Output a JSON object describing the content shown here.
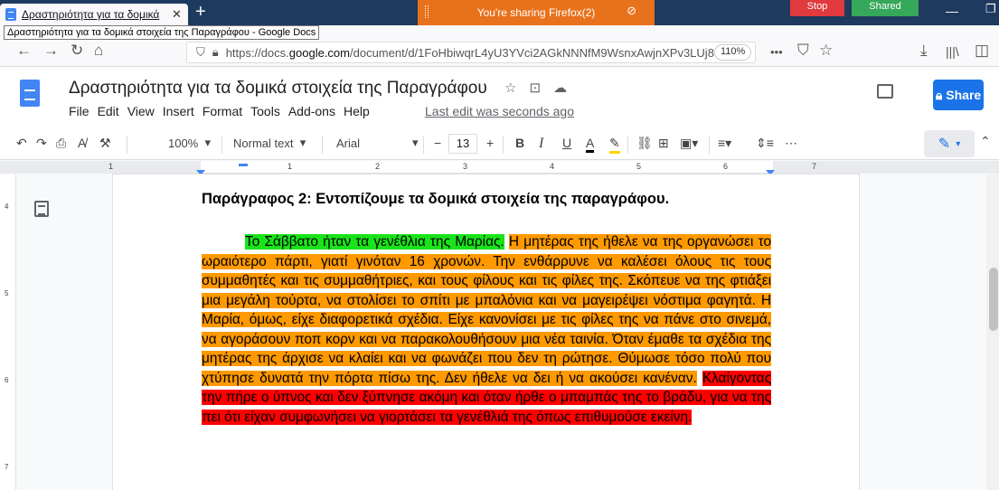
{
  "browser": {
    "tab_title": "Δραστηριότητα για τα δομικά",
    "tab_close": "✕",
    "new_tab": "+",
    "tooltip": "Δραστηριότητα για τα δομικά στοιχεία της Παραγράφου - Google Docs",
    "sharing_text": "You're sharing Firefox(2)",
    "stop_label": "Stop",
    "shared_label": "Shared",
    "url_prefix": "https://docs.",
    "url_domain": "google.com",
    "url_rest": "/document/d/1FoHbiwqrL4yU3YVci2AGkNNNfM9WsnxAwjnXPv3LUj8",
    "zoom": "110%",
    "more": "•••"
  },
  "docs": {
    "title": "Δραστηριότητα για τα δομικά στοιχεία της Παραγράφου",
    "menu": [
      "File",
      "Edit",
      "View",
      "Insert",
      "Format",
      "Tools",
      "Add-ons",
      "Help"
    ],
    "last_edit": "Last edit was seconds ago",
    "share_label": "Share",
    "zoom": "100%",
    "style": "Normal text",
    "font": "Arial",
    "font_size": "13"
  },
  "ruler": [
    "1",
    "1",
    "2",
    "3",
    "4",
    "5",
    "6",
    "7"
  ],
  "vruler": [
    "4",
    "5",
    "6",
    "7"
  ],
  "content": {
    "heading": "Παράγραφος 2: Εντοπίζουμε τα δομικά στοιχεία της παραγράφου.",
    "topic": "Το Σάββατο ήταν τα γενέθλια της Μαρίας.",
    "body": "Η μητέρας της ήθελε να της οργανώσει το ωραιότερο πάρτι, γιατί γινόταν 16 χρονών. Την ενθάρρυνε να καλέσει όλους τις τους συμμαθητές και τις συμμαθήτριες, και τους φίλους και τις φίλες της. Σκόπευε να της φτιάξει μια μεγάλη τούρτα, να στολίσει το σπίτι με μπαλόνια και να μαγειρέψει νόστιμα φαγητά. Η Μαρία, όμως, είχε διαφορετικά σχέδια. Είχε κανονίσει με τις φίλες της να πάνε στο σινεμά, να αγοράσουν ποπ κορν και να παρακολουθήσουν μια νέα ταινία. Όταν έμαθε τα σχέδια της μητέρας της άρχισε να κλαίει και να φωνάζει που δεν τη ρώτησε. Θύμωσε τόσο πολύ που χτύπησε δυνατά την πόρτα πίσω της. Δεν ήθελε να δει ή να ακούσει κανέναν.",
    "conclusion": "Κλαίγοντας την πήρε ο ύπνος και δεν ξύπνησε ακόμη και όταν ήρθε ο μπαμπάς της το βράδυ, για να της πει ότι είχαν συμφωνήσει να γιορτάσει τα γενέθλιά της όπως επιθυμούσε εκείνη."
  },
  "colors": {
    "topic_highlight": "#19e319",
    "body_highlight": "#ff9900",
    "conclusion_highlight": "#ff0000",
    "accent": "#1a73e8"
  }
}
